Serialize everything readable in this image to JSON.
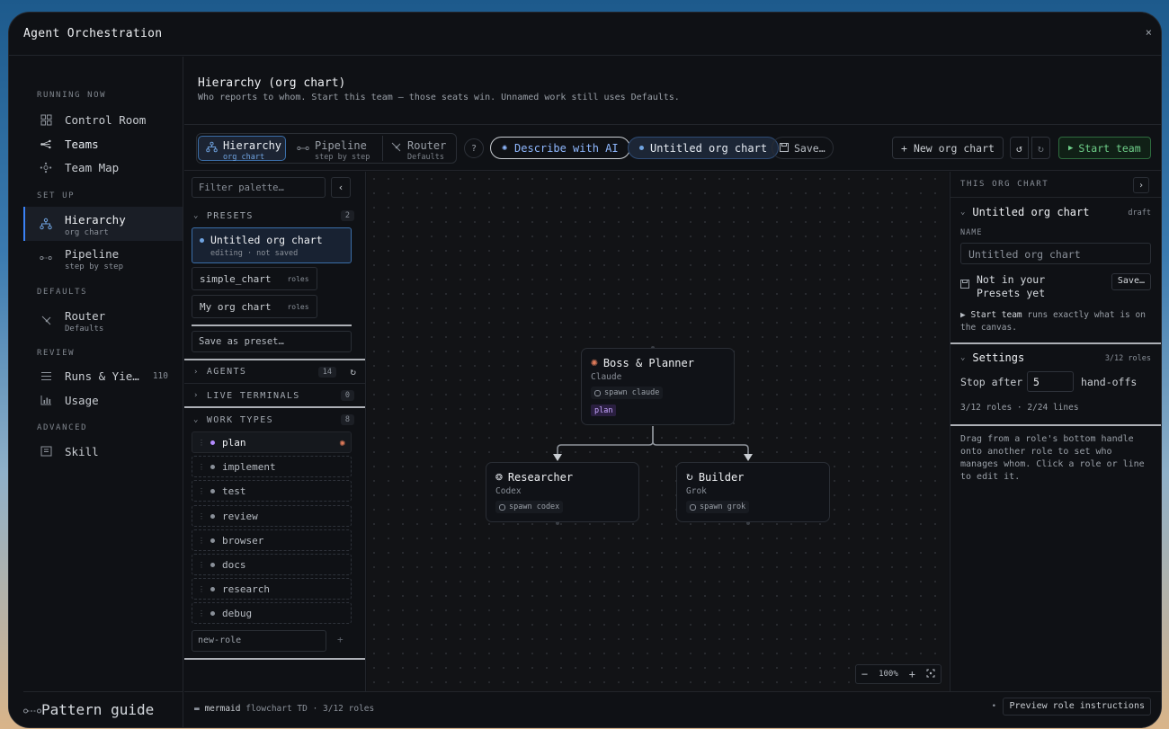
{
  "window": {
    "title": "Agent Orchestration",
    "close": "×"
  },
  "sidebar": {
    "sections": {
      "running_now": "RUNNING NOW",
      "set_up": "SET UP",
      "defaults": "DEFAULTS",
      "review": "REVIEW",
      "advanced": "ADVANCED"
    },
    "items": {
      "control_room": "Control Room",
      "teams": "Teams",
      "team_map": "Team Map",
      "hierarchy": "Hierarchy",
      "hierarchy_sub": "org chart",
      "pipeline": "Pipeline",
      "pipeline_sub": "step by step",
      "router": "Router",
      "router_sub": "Defaults",
      "runs": "Runs & Yie…",
      "runs_count": "110",
      "usage": "Usage",
      "skill": "Skill"
    },
    "footer": "Pattern guide"
  },
  "header": {
    "title": "Hierarchy (org chart)",
    "subtitle": "Who reports to whom. Start this team — those seats win. Unnamed work still uses Defaults."
  },
  "toolbar": {
    "modes": [
      {
        "label": "Hierarchy",
        "sub": "org chart"
      },
      {
        "label": "Pipeline",
        "sub": "step by step"
      },
      {
        "label": "Router",
        "sub": "Defaults"
      }
    ],
    "help": "?",
    "describe_ai": "Describe with AI",
    "chart_name": "Untitled org chart",
    "save": "Save…",
    "new_chart": "New org chart",
    "undo": "↺",
    "redo": "↻",
    "start_team": "Start team"
  },
  "palette": {
    "filter_placeholder": "Filter palette…",
    "presets_header": "PRESETS",
    "presets_count": "2",
    "active_preset": {
      "name": "Untitled org chart",
      "sub": "editing · not saved"
    },
    "presets": [
      {
        "name": "simple_chart",
        "tag": "roles"
      },
      {
        "name": "My org chart",
        "tag": "roles"
      }
    ],
    "save_as_preset": "Save as preset…",
    "agents_header": "AGENTS",
    "agents_count": "14",
    "terminals_header": "LIVE TERMINALS",
    "terminals_count": "0",
    "worktypes_header": "WORK TYPES",
    "worktypes_count": "8",
    "work_types": [
      "plan",
      "implement",
      "test",
      "review",
      "browser",
      "docs",
      "research",
      "debug"
    ],
    "new_role_placeholder": "new-role",
    "new_role_add": "+"
  },
  "canvas": {
    "nodes": {
      "boss": {
        "title": "Boss & Planner",
        "model": "Claude",
        "spawn": "spawn claude",
        "tag": "plan"
      },
      "researcher": {
        "title": "Researcher",
        "model": "Codex",
        "spawn": "spawn codex"
      },
      "builder": {
        "title": "Builder",
        "model": "Grok",
        "spawn": "spawn grok"
      }
    },
    "zoom": {
      "minus": "−",
      "level": "100%",
      "plus": "+"
    }
  },
  "right_panel": {
    "header": "THIS ORG CHART",
    "chart_title": "Untitled org chart",
    "chart_status": "draft",
    "name_label": "NAME",
    "name_placeholder": "Untitled org chart",
    "not_saved": "Not in your Presets yet",
    "save_btn": "Save…",
    "start_note_bold": "Start team",
    "start_note": "runs exactly what is on the canvas.",
    "settings_title": "Settings",
    "settings_roles": "3/12 roles",
    "stop_after": "Stop after",
    "stop_value": "5",
    "handoffs": "hand-offs",
    "summary": "3/12 roles · 2/24 lines",
    "help": "Drag from a role's bottom handle onto another role to set who manages whom. Click a role or line to edit it."
  },
  "statusbar": {
    "mermaid": "mermaid",
    "flow": "flowchart TD · 3/12 roles",
    "bullet": "•",
    "preview": "Preview role instructions"
  }
}
